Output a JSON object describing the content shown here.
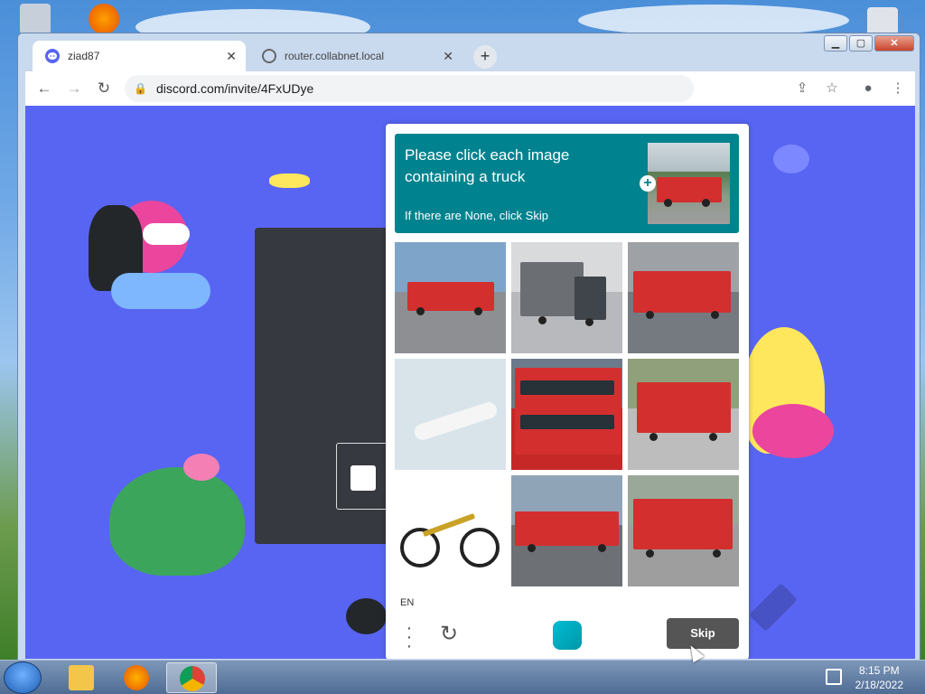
{
  "browser": {
    "tabs": [
      {
        "label": "ziad87",
        "favicon": "discord-icon",
        "active": true
      },
      {
        "label": "router.collabnet.local",
        "favicon": "globe-icon",
        "active": false
      }
    ],
    "new_tab": "+",
    "close_glyph": "✕",
    "url": "discord.com/invite/4FxUDye"
  },
  "captcha": {
    "title": "Please click each image containing a truck",
    "subtitle": "If there are None, click Skip",
    "language": "EN",
    "skip_label": "Skip",
    "tiles": [
      {
        "content": "fire-truck",
        "sky": "#7fa4c9",
        "ground": "#8d8f93"
      },
      {
        "content": "gray-truck",
        "sky": "#d9dadc",
        "ground": "#b8b9bc"
      },
      {
        "content": "fire-truck",
        "sky": "#9ea2a7",
        "ground": "#757a80"
      },
      {
        "content": "airplane",
        "sky": "#d9e4ea",
        "ground": "#c9d6de"
      },
      {
        "content": "red-bus",
        "sky": "#6b7b8b",
        "ground": "#c62828"
      },
      {
        "content": "fire-truck",
        "sky": "#8fa07a",
        "ground": "#bdbdbd"
      },
      {
        "content": "bicycle",
        "sky": "#ffffff",
        "ground": "#ffffff"
      },
      {
        "content": "fire-truck",
        "sky": "#90a4b8",
        "ground": "#6d7075"
      },
      {
        "content": "fire-truck",
        "sky": "#9aa89a",
        "ground": "#9e9e9e"
      }
    ]
  },
  "taskbar": {
    "time": "8:15 PM",
    "date": "2/18/2022"
  },
  "colors": {
    "discord_bg": "#5865f2",
    "captcha_header": "#00838f",
    "skip_button": "#555555"
  }
}
